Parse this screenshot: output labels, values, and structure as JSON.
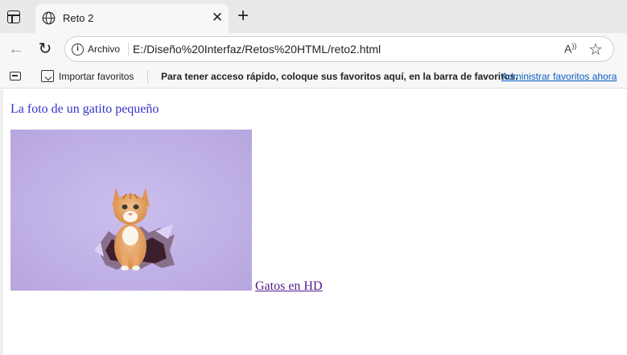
{
  "browser": {
    "tab": {
      "title": "Reto 2",
      "close_symbol": "✕"
    },
    "new_tab_symbol": "+",
    "address_bar": {
      "security_label": "Archivo",
      "url": "E:/Diseño%20Interfaz/Retos%20HTML/reto2.html",
      "read_aloud_symbol": "A"
    },
    "favorites_bar": {
      "import_label": "Importar favoritos",
      "message": "Para tener acceso rápido, coloque sus favoritos aquí, en la barra de favoritos.",
      "manage_link": "Administrar favoritos ahora"
    }
  },
  "page": {
    "heading": "La foto de un gatito pequeño",
    "image_link": "Gatos en HD",
    "image_alt": "gatito",
    "colors": {
      "heading": "#3333cc",
      "visited_link": "#551a8b",
      "photo_background": "#c2b3e6"
    }
  }
}
